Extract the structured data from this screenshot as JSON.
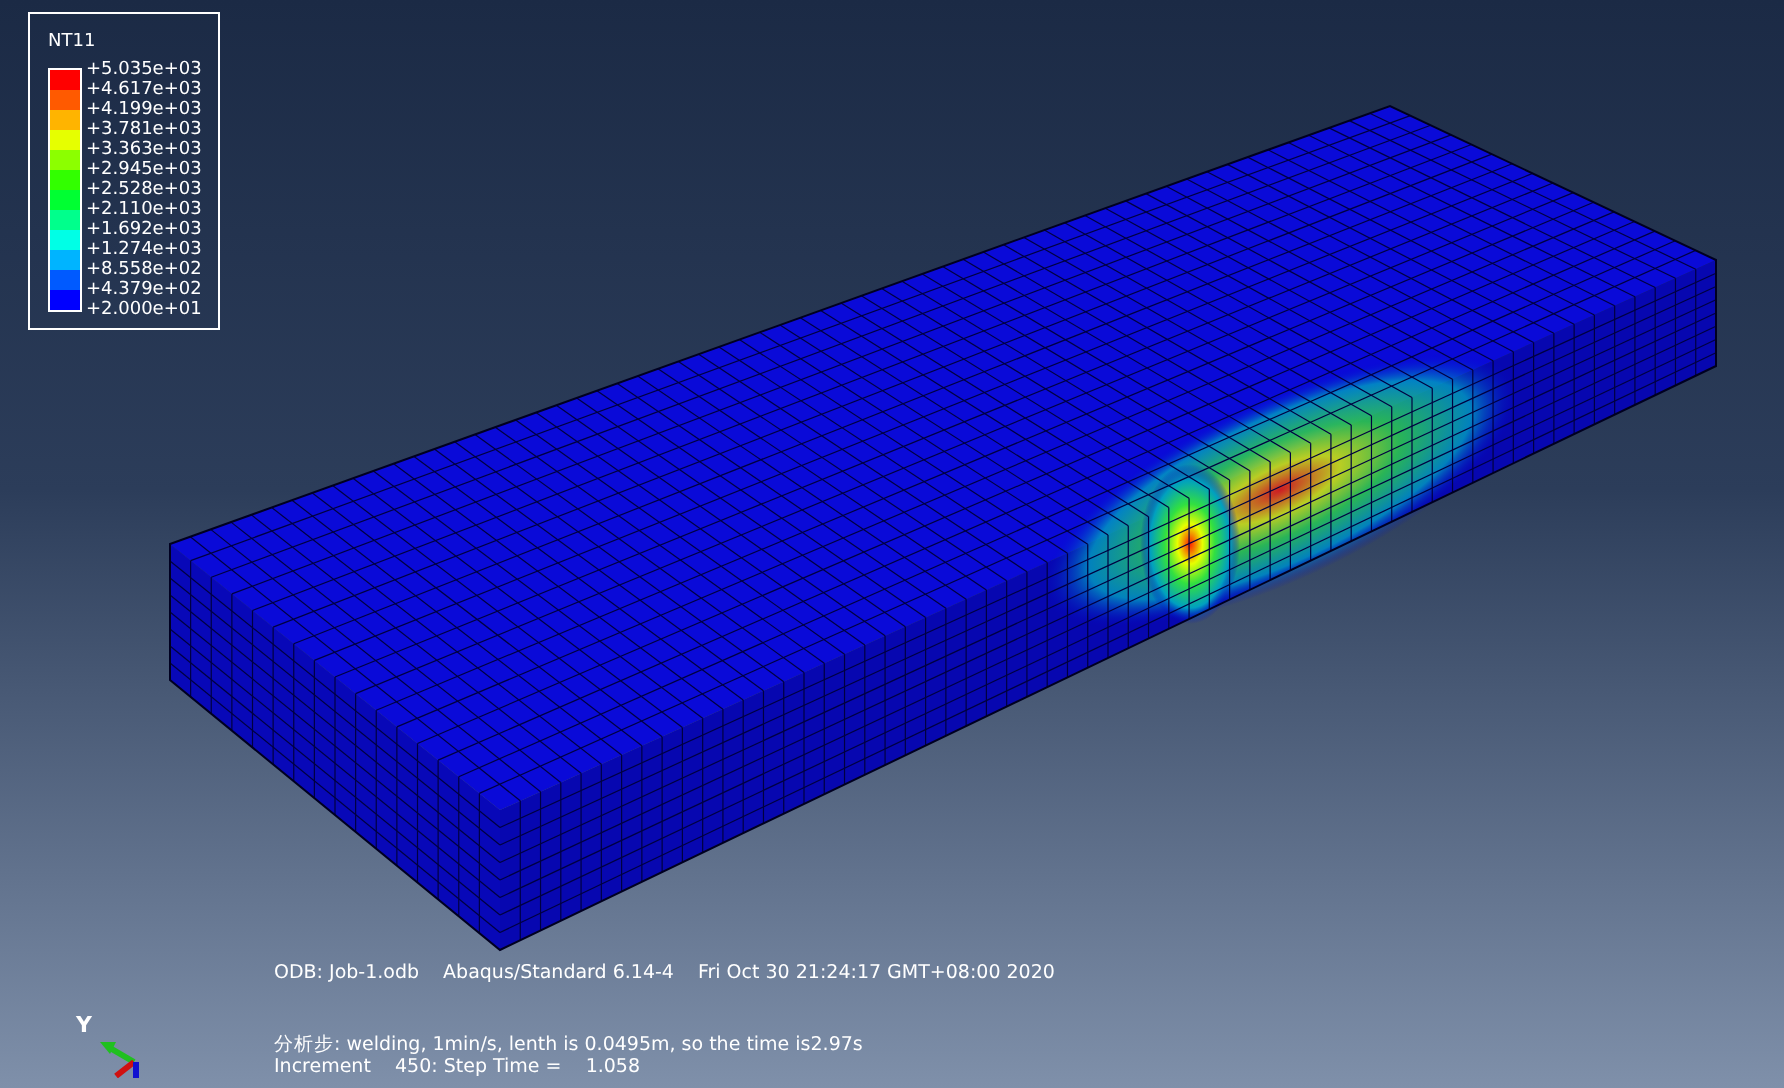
{
  "legend": {
    "title": "NT11",
    "bands": [
      {
        "color": "#ff0000"
      },
      {
        "color": "#ff5a00"
      },
      {
        "color": "#ffb400"
      },
      {
        "color": "#e6ff00"
      },
      {
        "color": "#8cff00"
      },
      {
        "color": "#32ff00"
      },
      {
        "color": "#00ff32"
      },
      {
        "color": "#00ff8c"
      },
      {
        "color": "#00ffe6"
      },
      {
        "color": "#00b4ff"
      },
      {
        "color": "#005aff"
      },
      {
        "color": "#0000ff"
      }
    ],
    "labels": [
      "+5.035e+03",
      "+4.617e+03",
      "+4.199e+03",
      "+3.781e+03",
      "+3.363e+03",
      "+2.945e+03",
      "+2.528e+03",
      "+2.110e+03",
      "+1.692e+03",
      "+1.274e+03",
      "+8.558e+02",
      "+4.379e+02",
      "+2.000e+01"
    ]
  },
  "info": {
    "odb": "ODB: Job-1.odb",
    "solver": "Abaqus/Standard 6.14-4",
    "date": "Fri Oct 30 21:24:17 GMT+08:00 2020"
  },
  "step": [
    "分析步: welding, 1min/s, lenth is 0.0495m, so the time is2.97s",
    "Increment    450: Step Time =    1.058"
  ],
  "triad": {
    "axis_label": "Y"
  }
}
